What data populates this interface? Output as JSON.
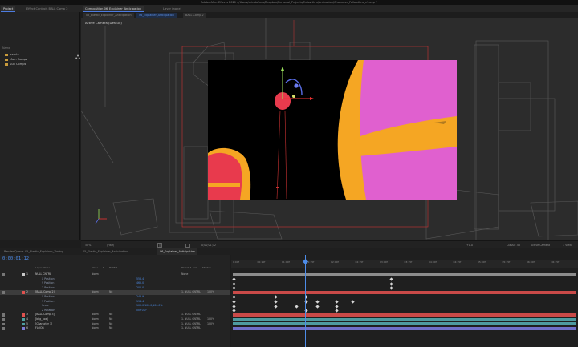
{
  "titlebar": {
    "text": "Adobe After Effects 2020 - /Users/ericstafano/Dropbox/Personal_Projects/Fallowthru/Animation/Character_Fallowthru_v1.aep *"
  },
  "project_tabs": [
    {
      "label": "Project",
      "active": true
    },
    {
      "label": "Effect Controls BALL Comp 2",
      "active": false
    }
  ],
  "comp_tabs": [
    {
      "label": "Composition 06_Explainer_Anticipation",
      "active": true
    },
    {
      "label": "Layer (none)",
      "active": false
    }
  ],
  "viewer_subtabs": [
    {
      "label": "05_Elastic_Explainer_Anticipation",
      "selected": false
    },
    {
      "label": "06_Explainer_Anticipation",
      "selected": true
    },
    {
      "label": "BALL Comp 2",
      "selected": false
    }
  ],
  "project": {
    "header": "Name",
    "items": [
      "assets",
      "Main Comps",
      "Sub Comps"
    ]
  },
  "viewer": {
    "camera_label": "Active Camera (Default)",
    "colors": {
      "comp_bg": "#000000",
      "pink": "#e060cf",
      "orange": "#f5a623",
      "red": "#e83a4d",
      "accent": "#4d8ce8",
      "guide": "#cc3333"
    }
  },
  "viewer_bar": {
    "zoom": "50%",
    "resolution": "(Half)",
    "timecode": "0;00;01;12",
    "exposure": "+0.0",
    "renderer": "Classic 3D",
    "camera": "Active Camera",
    "views": "1 View"
  },
  "timeline_tabs": [
    {
      "label": "Render Queue",
      "selected": false
    },
    {
      "label": "05_Elastic_Explainer_Timing",
      "selected": false
    },
    {
      "label": "05_Elastic_Explainer_Anticipation",
      "selected": false
    },
    {
      "label": "06_Explainer_Anticipation",
      "selected": true
    }
  ],
  "timeline": {
    "timecode": "0;00;01;12",
    "columns": [
      "Layer Name",
      "Mode",
      "T",
      "TrkMat",
      "Parent & Link",
      "Stretch"
    ],
    "layers": [
      {
        "kind": "layer",
        "num": "1",
        "name": "NULL CNTRL",
        "mode": "Norm",
        "trkmat": "",
        "parent": "None",
        "stretch": "",
        "color": "#c9c9c9"
      },
      {
        "kind": "prop",
        "name": "X Position",
        "value": "556.4"
      },
      {
        "kind": "prop",
        "name": "Y Position",
        "value": "465.0"
      },
      {
        "kind": "prop",
        "name": "Z Position",
        "value": "200.0"
      },
      {
        "kind": "layer",
        "num": "2",
        "name": "[BALL Comp 2]",
        "mode": "Norm",
        "trkmat": "No",
        "parent": "1. NULL CNTRL",
        "stretch": "100%",
        "color": "#e0524f",
        "selected": true
      },
      {
        "kind": "prop",
        "name": "X Position",
        "value": "243.9"
      },
      {
        "kind": "prop",
        "name": "Y Position",
        "value": "194.4"
      },
      {
        "kind": "prop",
        "name": "Scale",
        "value": "100.0,100.0,100.0%"
      },
      {
        "kind": "prop",
        "name": "Z Rotation",
        "value": "0x+0.0°"
      },
      {
        "kind": "layer",
        "num": "3",
        "name": "[BALL Comp 3]",
        "mode": "Norm",
        "trkmat": "No",
        "parent": "1. NULL CNTRL",
        "stretch": "",
        "color": "#e0524f"
      },
      {
        "kind": "layer",
        "num": "4",
        "name": "[bkg_pos]",
        "mode": "Norm",
        "trkmat": "No",
        "parent": "1. NULL CNTRL",
        "stretch": "100%",
        "color": "#4ea0a0"
      },
      {
        "kind": "layer",
        "num": "5",
        "name": "[Character 1]",
        "mode": "Norm",
        "trkmat": "No",
        "parent": "1. NULL CNTRL",
        "stretch": "100%",
        "color": "#4ea0a0"
      },
      {
        "kind": "layer",
        "num": "6",
        "name": "FLOOR",
        "mode": "Norm",
        "trkmat": "No",
        "parent": "1. NULL CNTRL",
        "stretch": "",
        "color": "#7d7dd6"
      }
    ],
    "ruler_ticks": [
      "0:00f",
      "00:15f",
      "01:00f",
      "01:15f",
      "02:00f",
      "02:15f",
      "03:00f",
      "03:15f",
      "04:00f",
      "04:15f",
      "05:00f",
      "05:15f",
      "06:00f",
      "06:15f"
    ]
  },
  "icons": [
    "folder-icon",
    "camera-icon",
    "grid-icon",
    "snapshot-icon",
    "eye-icon",
    "lock-icon",
    "playhead-icon"
  ]
}
